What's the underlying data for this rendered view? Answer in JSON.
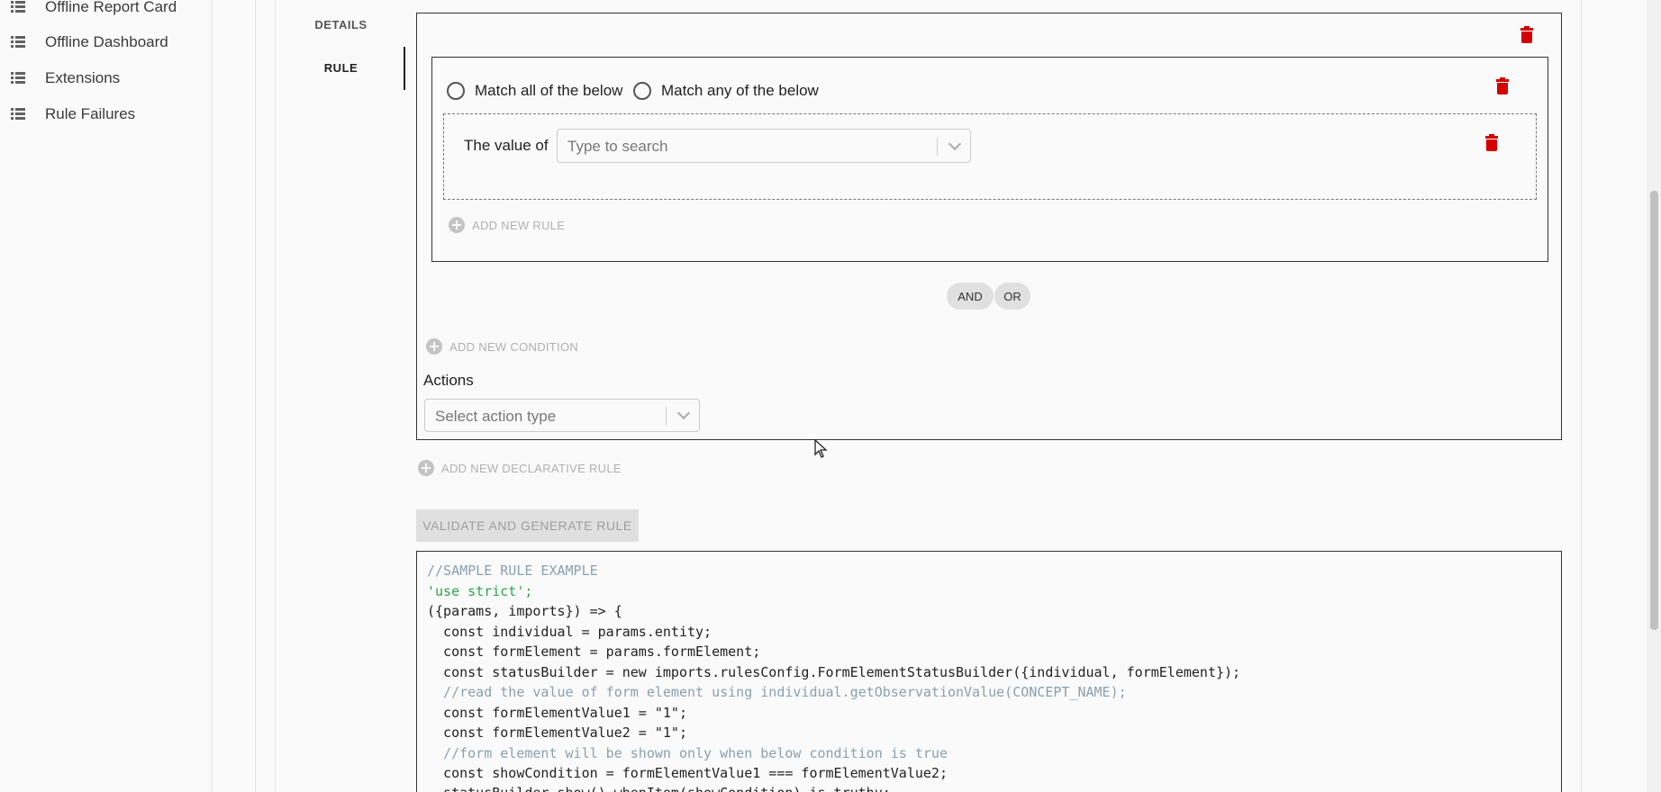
{
  "sidebar": {
    "items": [
      {
        "label": "Offline Report Card",
        "icon": "list-icon"
      },
      {
        "label": "Offline Dashboard",
        "icon": "list-icon"
      },
      {
        "label": "Extensions",
        "icon": "list-icon"
      },
      {
        "label": "Rule Failures",
        "icon": "list-icon"
      }
    ]
  },
  "tabs": [
    {
      "label": "DETAILS",
      "selected": false
    },
    {
      "label": "RULE",
      "selected": true
    }
  ],
  "rule": {
    "condition": {
      "match_all_label": "Match all of the below",
      "match_any_label": "Match any of the below",
      "value_of_label": "The value of",
      "search_placeholder": "Type to search",
      "add_new_rule": "ADD NEW RULE"
    },
    "join_options": [
      "AND",
      "OR"
    ],
    "add_new_condition": "ADD NEW CONDITION",
    "actions_label": "Actions",
    "action_placeholder": "Select action type"
  },
  "add_new_declarative_rule": "ADD NEW DECLARATIVE RULE",
  "validate_button": "VALIDATE AND GENERATE RULE",
  "code_lines": [
    "//SAMPLE RULE EXAMPLE",
    "'use strict';",
    "({params, imports}) => {",
    "  const individual = params.entity;",
    "  const formElement = params.formElement;",
    "  const statusBuilder = new imports.rulesConfig.FormElementStatusBuilder({individual, formElement});",
    "  //read the value of form element using individual.getObservationValue(CONCEPT_NAME);",
    "  const formElementValue1 = \"1\";",
    "  const formElementValue2 = \"1\";",
    "  //form element will be shown only when below condition is true",
    "  const showCondition = formElementValue1 === formElementValue2;",
    "  statusBuilder.show().whenItem(showCondition).is.truthy;"
  ],
  "colors": {
    "delete": "#d50000",
    "comment": "#8aa0b0",
    "string": "#2da44e",
    "keyword": "#1a237e"
  }
}
